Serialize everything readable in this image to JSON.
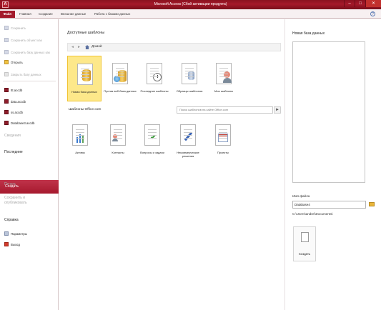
{
  "window": {
    "title": "Microsoft Access (Сбой активации продукта)",
    "app_letter": "A"
  },
  "ribbon": {
    "file_tab": "Файл",
    "tabs": [
      "Главная",
      "Создание",
      "Внешние данные",
      "Работа с базами данных"
    ],
    "help": "?"
  },
  "sidebar": {
    "commands_top": [
      {
        "label": "Сохранить",
        "icon": "save-icon",
        "enabled": false
      },
      {
        "label": "Сохранить объект как",
        "icon": "save-as-icon",
        "enabled": false
      },
      {
        "label": "Сохранить базу данных как",
        "icon": "save-db-as-icon",
        "enabled": false
      },
      {
        "label": "Открыть",
        "icon": "open-folder-icon",
        "enabled": true
      },
      {
        "label": "Закрыть базу данных",
        "icon": "close-db-icon",
        "enabled": false
      }
    ],
    "recent_files": [
      "ttt.accdb",
      "data.accdb",
      "ss.accdb",
      "Database3.accdb"
    ],
    "info": "Сведения",
    "recent": "Последние",
    "create": "Создать",
    "print": "Печать",
    "save_publish": "Сохранить и опубликовать",
    "help": "Справка",
    "options": "Параметры",
    "exit": "Выход"
  },
  "main": {
    "available_templates": "Доступные шаблоны",
    "nav": {
      "back": "◄",
      "forward": "►",
      "home": "Домой"
    },
    "templates": [
      "Новая база данных",
      "Пустая веб-база данных",
      "Последние шаблоны",
      "Образцы шаблонов",
      "Мои шаблоны"
    ],
    "office_title": "Шаблоны Office.com",
    "office_search_placeholder": "Поиск шаблонов на сайте Office.com",
    "office_go": "►",
    "office_templates": [
      "Активы",
      "Контакты",
      "Вопросы и задачи",
      "Некоммерческие решения",
      "Проекты"
    ]
  },
  "right": {
    "heading": "Новая база данных",
    "file_name_label": "Имя файла",
    "file_name_value": "Database4",
    "path": "C:\\Users\\andrei\\Documents\\",
    "create_button": "Создать"
  }
}
